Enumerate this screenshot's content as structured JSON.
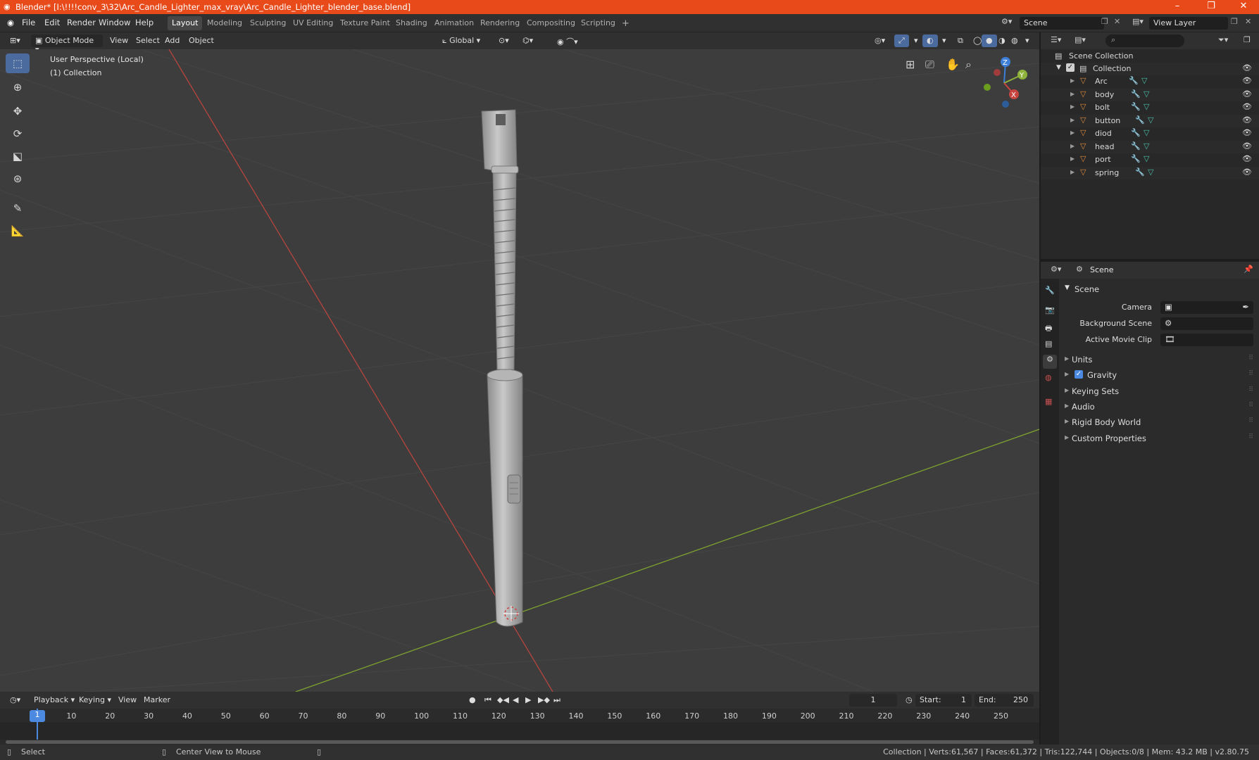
{
  "window": {
    "title": "Blender* [I:\\!!!!conv_3\\32\\Arc_Candle_Lighter_max_vray\\Arc_Candle_Lighter_blender_base.blend]",
    "minimize": "–",
    "restore": "❐",
    "close": "✕"
  },
  "menubar": {
    "items": [
      "File",
      "Edit",
      "Render",
      "Window",
      "Help"
    ]
  },
  "workspaces": {
    "tabs": [
      "Layout",
      "Modeling",
      "Sculpting",
      "UV Editing",
      "Texture Paint",
      "Shading",
      "Animation",
      "Rendering",
      "Compositing",
      "Scripting"
    ],
    "add": "+"
  },
  "scene_selector": {
    "value": "Scene"
  },
  "view_layer_selector": {
    "value": "View Layer"
  },
  "viewport_header": {
    "mode": "Object Mode",
    "menus": [
      "View",
      "Select",
      "Add",
      "Object"
    ],
    "orientation": "Global"
  },
  "viewport": {
    "perspective": "User Perspective (Local)",
    "collection": "(1) Collection",
    "gizmo": {
      "z": "Z",
      "y": "Y",
      "x": "X"
    }
  },
  "outliner": {
    "root": "Scene Collection",
    "collection": "Collection",
    "objects": [
      "Arc",
      "body",
      "bolt",
      "button",
      "diod",
      "head",
      "port",
      "spring"
    ]
  },
  "properties": {
    "context": "Scene",
    "section": "Scene",
    "fields": [
      {
        "label": "Camera"
      },
      {
        "label": "Background Scene"
      },
      {
        "label": "Active Movie Clip"
      }
    ],
    "panels": [
      "Units",
      "Gravity",
      "Keying Sets",
      "Audio",
      "Rigid Body World",
      "Custom Properties"
    ],
    "gravity_checked": true
  },
  "timeline": {
    "menus": [
      "Playback",
      "Keying",
      "View",
      "Marker"
    ],
    "current_frame": "1",
    "start_label": "Start:",
    "start": "1",
    "end_label": "End:",
    "end": "250",
    "ticks": [
      "1",
      "10",
      "20",
      "30",
      "40",
      "50",
      "60",
      "70",
      "80",
      "90",
      "100",
      "110",
      "120",
      "130",
      "140",
      "150",
      "160",
      "170",
      "180",
      "190",
      "200",
      "210",
      "220",
      "230",
      "240",
      "250"
    ]
  },
  "statusbar": {
    "left": "Select",
    "middle": "Center View to Mouse",
    "stats": "Collection | Verts:61,567 | Faces:61,372 | Tris:122,744 | Objects:0/8 | Mem: 43.2 MB | v2.80.75"
  },
  "colors": {
    "titlebar": "#e84a1a",
    "accent": "#4b6a9e",
    "x_axis": "#c8453f",
    "y_axis": "#8fb33a",
    "z_axis": "#3d7fd9"
  }
}
